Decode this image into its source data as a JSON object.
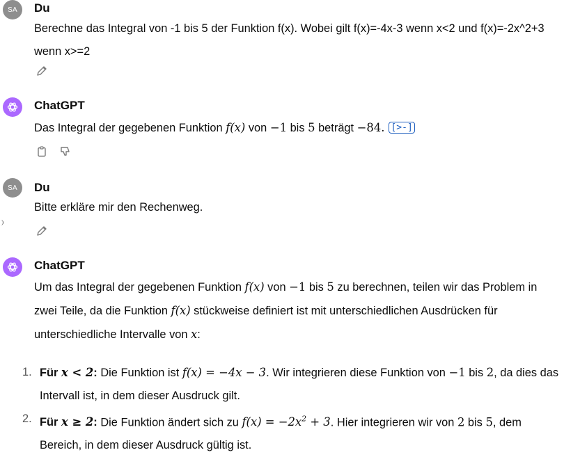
{
  "messages": [
    {
      "author": "Du",
      "avatar": "SA",
      "text": "Berechne das Integral von -1 bis 5 der Funktion f(x). Wobei gilt f(x)=-4x-3 wenn x<2 und f(x)=-2x^2+3 wenn x>=2",
      "actions": [
        "edit-icon"
      ]
    },
    {
      "author": "ChatGPT",
      "answer": {
        "pre": "Das Integral der gegebenen Funktion ",
        "f": "f(x)",
        "mid1": " von ",
        "a": "−1",
        "mid2": " bis ",
        "b": "5",
        "mid3": " beträgt ",
        "result": "−84.",
        "source_label": "[>-]"
      },
      "actions": [
        "copy-icon",
        "thumbs-down-icon"
      ]
    },
    {
      "author": "Du",
      "avatar": "SA",
      "text": "Bitte erkläre mir den Rechenweg.",
      "actions": [
        "edit-icon"
      ]
    },
    {
      "author": "ChatGPT",
      "intro": {
        "t1": "Um das Integral der gegebenen Funktion ",
        "f1": "f(x)",
        "t2": " von ",
        "a": "−1",
        "t3": " bis ",
        "b": "5",
        "t4": " zu berechnen, teilen wir das Problem in zwei Teile, da die Funktion ",
        "f2": "f(x)",
        "t5": " stückweise definiert ist mit unterschiedlichen Ausdrücken für unterschiedliche Intervalle von ",
        "x": "x",
        "t6": ":"
      },
      "list": [
        {
          "num": "1.",
          "bold_pre": "Für ",
          "cond": "x < 2",
          "bold_post": ":",
          "t1": " Die Funktion ist ",
          "expr": "f(x) = −4x − 3",
          "t2": ". Wir integrieren diese Funktion von ",
          "a": "−1",
          "t3": " bis ",
          "b": "2",
          "t4": ", da dies das Intervall ist, in dem dieser Ausdruck gilt."
        },
        {
          "num": "2.",
          "bold_pre": "Für ",
          "cond": "x ≥ 2",
          "bold_post": ":",
          "t1": " Die Funktion ändert sich zu ",
          "expr_a": "f(x) = −2x",
          "expr_sup": "2",
          "expr_b": " + 3",
          "t2": ". Hier integrieren wir von ",
          "a": "2",
          "t3": " bis ",
          "b": "5",
          "t4": ", dem Bereich, in dem dieser Ausdruck gültig ist."
        }
      ]
    }
  ]
}
